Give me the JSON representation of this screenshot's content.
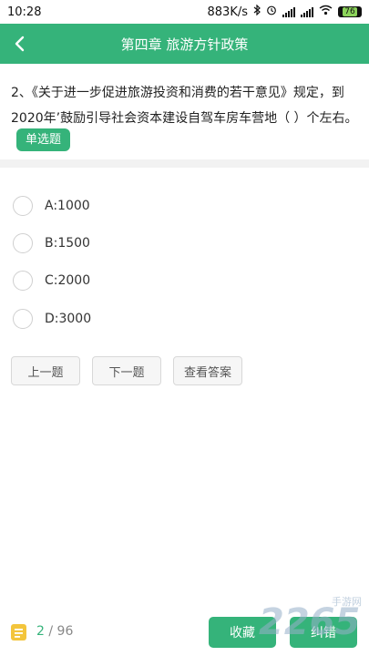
{
  "status_bar": {
    "time": "10:28",
    "speed": "883K/s",
    "battery": "76"
  },
  "header": {
    "title": "第四章 旅游方针政策"
  },
  "question": {
    "text": "2、《关于进一步促进旅游投资和消费的若干意见》规定，到2020年’鼓励引导社会资本建设自驾车房车营地（ ）个左右。",
    "type_label": "单选题"
  },
  "options": [
    {
      "label": "A:1000"
    },
    {
      "label": "B:1500"
    },
    {
      "label": "C:2000"
    },
    {
      "label": "D:3000"
    }
  ],
  "actions": {
    "prev": "上一题",
    "next": "下一题",
    "answer": "查看答案"
  },
  "footer": {
    "current": "2",
    "separator": "/",
    "total": "96",
    "collect": "收藏",
    "report": "纠错"
  },
  "watermark": {
    "number": "2265",
    "text": "手游网"
  },
  "colors": {
    "accent": "#35b37a",
    "note_icon": "#f3c53c"
  }
}
